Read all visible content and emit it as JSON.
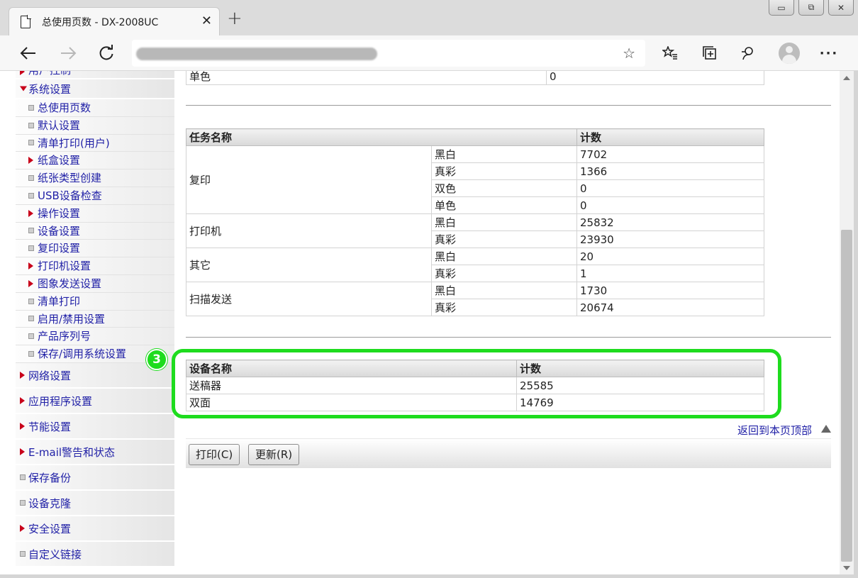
{
  "browser": {
    "tab_title": "总使用页数 - DX-2008UC",
    "tab_close": "✕",
    "new_tab": "+",
    "address_url": "html",
    "window_controls": {
      "minimize": "▭",
      "restore": "⧉",
      "close": "✕"
    },
    "icons": [
      "back-icon",
      "forward-icon",
      "refresh-icon",
      "favorite-star-icon",
      "favorites-list-icon",
      "collections-icon",
      "feedback-icon",
      "profile-icon",
      "more-icon"
    ]
  },
  "sidebar": {
    "top_partial": "用户控制",
    "system_settings": "系统设置",
    "sub_items": [
      {
        "label": "总使用页数",
        "marker": "square"
      },
      {
        "label": "默认设置",
        "marker": "square"
      },
      {
        "label": "清单打印(用户)",
        "marker": "square"
      },
      {
        "label": "纸盒设置",
        "marker": "triangle"
      },
      {
        "label": "纸张类型创建",
        "marker": "square"
      },
      {
        "label": "USB设备检查",
        "marker": "square"
      },
      {
        "label": "操作设置",
        "marker": "triangle"
      },
      {
        "label": "设备设置",
        "marker": "square"
      },
      {
        "label": "复印设置",
        "marker": "square"
      },
      {
        "label": "打印机设置",
        "marker": "triangle"
      },
      {
        "label": "图象发送设置",
        "marker": "triangle"
      },
      {
        "label": "清单打印",
        "marker": "square"
      },
      {
        "label": "启用/禁用设置",
        "marker": "square"
      },
      {
        "label": "产品序列号",
        "marker": "square"
      },
      {
        "label": "保存/调用系统设置",
        "marker": "square"
      }
    ],
    "top_items": [
      {
        "label": "网络设置",
        "marker": "triangle"
      },
      {
        "label": "应用程序设置",
        "marker": "triangle"
      },
      {
        "label": "节能设置",
        "marker": "triangle"
      },
      {
        "label": "E-mail警告和状态",
        "marker": "triangle"
      },
      {
        "label": "保存备份",
        "marker": "square"
      },
      {
        "label": "设备克隆",
        "marker": "square"
      },
      {
        "label": "安全设置",
        "marker": "triangle"
      },
      {
        "label": "自定义链接",
        "marker": "square"
      }
    ]
  },
  "top_table": {
    "label": "单色",
    "value": "0"
  },
  "job_table": {
    "headers": {
      "name": "任务名称",
      "count": "计数"
    },
    "groups": [
      {
        "name": "复印",
        "rows": [
          {
            "mode": "黑白",
            "count": "7702"
          },
          {
            "mode": "真彩",
            "count": "1366"
          },
          {
            "mode": "双色",
            "count": "0"
          },
          {
            "mode": "单色",
            "count": "0"
          }
        ]
      },
      {
        "name": "打印机",
        "rows": [
          {
            "mode": "黑白",
            "count": "25832"
          },
          {
            "mode": "真彩",
            "count": "23930"
          }
        ]
      },
      {
        "name": "其它",
        "rows": [
          {
            "mode": "黑白",
            "count": "20"
          },
          {
            "mode": "真彩",
            "count": "1"
          }
        ]
      },
      {
        "name": "扫描发送",
        "rows": [
          {
            "mode": "黑白",
            "count": "1730"
          },
          {
            "mode": "真彩",
            "count": "20674"
          }
        ]
      }
    ]
  },
  "device_table": {
    "headers": {
      "name": "设备名称",
      "count": "计数"
    },
    "rows": [
      {
        "name": "送稿器",
        "count": "25585"
      },
      {
        "name": "双面",
        "count": "14769"
      }
    ]
  },
  "annotation": {
    "badge": "3",
    "color": "#1edc1e"
  },
  "links": {
    "back_to_top": "返回到本页顶部"
  },
  "buttons": {
    "print": "打印(C)",
    "refresh": "更新(R)"
  },
  "colors": {
    "link": "#1f1fa6",
    "marker": "#c8001a"
  }
}
